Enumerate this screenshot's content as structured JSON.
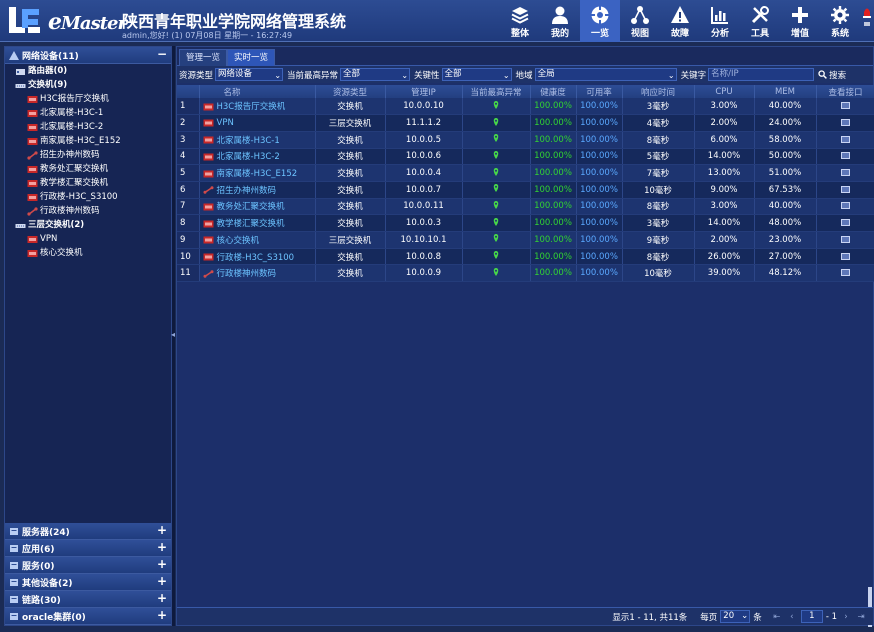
{
  "header": {
    "brand": "Master",
    "brand_prefix": "e",
    "title": "陕西青年职业学院网络管理系统",
    "user_line": "admin,您好! (1) 07月08日 星期一 - 16:27:49",
    "nav": [
      {
        "label": "整体",
        "icon": "layers-icon"
      },
      {
        "label": "我的",
        "icon": "user-icon"
      },
      {
        "label": "一览",
        "icon": "dashboard-icon",
        "active": true
      },
      {
        "label": "视图",
        "icon": "topology-icon"
      },
      {
        "label": "故障",
        "icon": "warning-icon"
      },
      {
        "label": "分析",
        "icon": "chart-icon"
      },
      {
        "label": "工具",
        "icon": "tools-icon"
      },
      {
        "label": "增值",
        "icon": "plus-icon"
      },
      {
        "label": "系统",
        "icon": "gear-icon"
      }
    ]
  },
  "sidebar": {
    "top_group": {
      "label": "网络设备(11)",
      "toggle": "−"
    },
    "tree": [
      {
        "label": "路由器(0)",
        "level": 1,
        "icon": "router-icon"
      },
      {
        "label": "交换机(9)",
        "level": 1,
        "icon": "switch-group-icon"
      },
      {
        "label": "H3C报告厅交换机",
        "level": 2,
        "icon": "switch-icon"
      },
      {
        "label": "北家属楼-H3C-1",
        "level": 2,
        "icon": "switch-icon"
      },
      {
        "label": "北家属楼-H3C-2",
        "level": 2,
        "icon": "switch-icon"
      },
      {
        "label": "南家属楼-H3C_E152",
        "level": 2,
        "icon": "switch-icon"
      },
      {
        "label": "招生办神州数码",
        "level": 2,
        "icon": "link-icon"
      },
      {
        "label": "教务处汇聚交换机",
        "level": 2,
        "icon": "switch-icon"
      },
      {
        "label": "教学楼汇聚交换机",
        "level": 2,
        "icon": "switch-icon"
      },
      {
        "label": "行政楼-H3C_S3100",
        "level": 2,
        "icon": "switch-icon"
      },
      {
        "label": "行政楼神州数码",
        "level": 2,
        "icon": "link-icon"
      },
      {
        "label": "三层交换机(2)",
        "level": 1,
        "icon": "switch-group-icon"
      },
      {
        "label": "VPN",
        "level": 2,
        "icon": "switch-icon"
      },
      {
        "label": "核心交换机",
        "level": 2,
        "icon": "switch-icon"
      }
    ],
    "bottom_groups": [
      {
        "label": "服务器(24)",
        "toggle": "+"
      },
      {
        "label": "应用(6)",
        "toggle": "+"
      },
      {
        "label": "服务(0)",
        "toggle": "+"
      },
      {
        "label": "其他设备(2)",
        "toggle": "+"
      },
      {
        "label": "链路(30)",
        "toggle": "+"
      },
      {
        "label": "oracle集群(0)",
        "toggle": "+"
      }
    ]
  },
  "tabs": [
    {
      "label": "管理一览",
      "active": false
    },
    {
      "label": "实时一览",
      "active": true
    }
  ],
  "filters": {
    "res_type_label": "资源类型",
    "res_type_value": "网络设备",
    "alarm_label": "当前最高异常",
    "alarm_value": "全部",
    "key_label": "关键性",
    "key_value": "全部",
    "region_label": "地域",
    "region_value": "全局",
    "keyword_label": "关键字",
    "keyword_placeholder": "名称/IP",
    "search_label": "搜索"
  },
  "table": {
    "columns": [
      "",
      "名称",
      "资源类型",
      "管理IP",
      "当前最高异常",
      "健康度",
      "可用率",
      "响应时间",
      "CPU",
      "MEM",
      "查看接口"
    ],
    "rows": [
      {
        "no": "1",
        "name": "H3C报告厅交换机",
        "type": "交换机",
        "ip": "10.0.0.10",
        "health": "100.00%",
        "avail": "100.00%",
        "resp": "3毫秒",
        "cpu": "3.00%",
        "mem": "40.00%",
        "icon": "switch-icon"
      },
      {
        "no": "2",
        "name": "VPN",
        "type": "三层交换机",
        "ip": "11.1.1.2",
        "health": "100.00%",
        "avail": "100.00%",
        "resp": "4毫秒",
        "cpu": "2.00%",
        "mem": "24.00%",
        "icon": "switch-icon"
      },
      {
        "no": "3",
        "name": "北家属楼-H3C-1",
        "type": "交换机",
        "ip": "10.0.0.5",
        "health": "100.00%",
        "avail": "100.00%",
        "resp": "8毫秒",
        "cpu": "6.00%",
        "mem": "58.00%",
        "icon": "switch-icon"
      },
      {
        "no": "4",
        "name": "北家属楼-H3C-2",
        "type": "交换机",
        "ip": "10.0.0.6",
        "health": "100.00%",
        "avail": "100.00%",
        "resp": "5毫秒",
        "cpu": "14.00%",
        "mem": "50.00%",
        "icon": "switch-icon"
      },
      {
        "no": "5",
        "name": "南家属楼-H3C_E152",
        "type": "交换机",
        "ip": "10.0.0.4",
        "health": "100.00%",
        "avail": "100.00%",
        "resp": "7毫秒",
        "cpu": "13.00%",
        "mem": "51.00%",
        "icon": "switch-icon"
      },
      {
        "no": "6",
        "name": "招生办神州数码",
        "type": "交换机",
        "ip": "10.0.0.7",
        "health": "100.00%",
        "avail": "100.00%",
        "resp": "10毫秒",
        "cpu": "9.00%",
        "mem": "67.53%",
        "icon": "link-icon"
      },
      {
        "no": "7",
        "name": "教务处汇聚交换机",
        "type": "交换机",
        "ip": "10.0.0.11",
        "health": "100.00%",
        "avail": "100.00%",
        "resp": "8毫秒",
        "cpu": "3.00%",
        "mem": "40.00%",
        "icon": "switch-icon"
      },
      {
        "no": "8",
        "name": "教学楼汇聚交换机",
        "type": "交换机",
        "ip": "10.0.0.3",
        "health": "100.00%",
        "avail": "100.00%",
        "resp": "3毫秒",
        "cpu": "14.00%",
        "mem": "48.00%",
        "icon": "switch-icon"
      },
      {
        "no": "9",
        "name": "核心交换机",
        "type": "三层交换机",
        "ip": "10.10.10.1",
        "health": "100.00%",
        "avail": "100.00%",
        "resp": "9毫秒",
        "cpu": "2.00%",
        "mem": "23.00%",
        "icon": "switch-icon"
      },
      {
        "no": "10",
        "name": "行政楼-H3C_S3100",
        "type": "交换机",
        "ip": "10.0.0.8",
        "health": "100.00%",
        "avail": "100.00%",
        "resp": "8毫秒",
        "cpu": "26.00%",
        "mem": "27.00%",
        "icon": "switch-icon"
      },
      {
        "no": "11",
        "name": "行政楼神州数码",
        "type": "交换机",
        "ip": "10.0.0.9",
        "health": "100.00%",
        "avail": "100.00%",
        "resp": "10毫秒",
        "cpu": "39.00%",
        "mem": "48.12%",
        "icon": "link-icon"
      }
    ]
  },
  "pager": {
    "summary": "显示1 - 11, 共11条",
    "per_page_label": "每页",
    "per_page_value": "20",
    "per_page_unit": "条",
    "page_input": "1",
    "page_total": "- 1"
  },
  "colors": {
    "header": "#2d4c93",
    "active_nav": "#3b63c2",
    "health_green": "#32d332",
    "avail_blue": "#5aa8ff",
    "name_link": "#6cc3ff",
    "alarm_red": "#e02020"
  }
}
